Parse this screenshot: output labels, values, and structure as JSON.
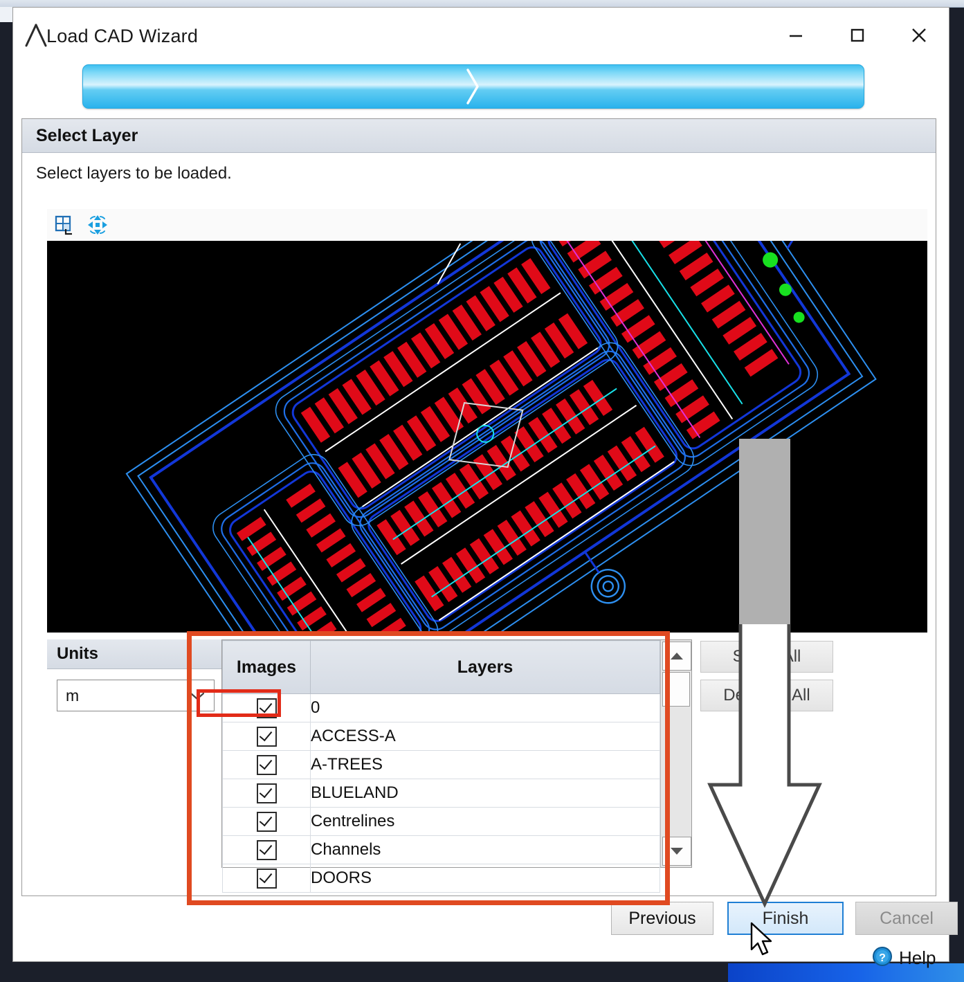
{
  "window": {
    "title": "Load CAD Wizard",
    "logo_icon": "autocad-a-icon",
    "controls": {
      "minimize": "minimize-icon",
      "maximize": "maximize-icon",
      "close": "close-icon"
    }
  },
  "progress": {
    "icon": "chevron-right-separator",
    "accent_color": "#3fc0f0"
  },
  "section": {
    "title": "Select Layer",
    "subtitle": "Select layers to be loaded."
  },
  "viewer": {
    "tools": [
      {
        "name": "zoom-window-icon",
        "label": "Zoom Window"
      },
      {
        "name": "pan-all-icon",
        "label": "Pan / Zoom Extents"
      }
    ],
    "background_color": "#000000"
  },
  "units": {
    "header": "Units",
    "selected": "m",
    "dropdown_icon": "chevron-down-icon"
  },
  "layer_table": {
    "columns": [
      "Images",
      "Layers"
    ],
    "rows": [
      {
        "checked": true,
        "name": "0"
      },
      {
        "checked": true,
        "name": "ACCESS-A"
      },
      {
        "checked": true,
        "name": "A-TREES"
      },
      {
        "checked": true,
        "name": "BLUELAND"
      },
      {
        "checked": true,
        "name": "Centrelines"
      },
      {
        "checked": true,
        "name": "Channels"
      },
      {
        "checked": true,
        "name": "DOORS"
      }
    ],
    "scrollbar": {
      "up_icon": "scroll-up-arrow-icon",
      "down_icon": "scroll-down-arrow-icon"
    }
  },
  "side_buttons": {
    "select_all": "Select All",
    "deselect_all": "Deselect All"
  },
  "footer": {
    "previous": "Previous",
    "finish": "Finish",
    "cancel": "Cancel",
    "help": "Help",
    "help_icon": "question-mark-icon"
  },
  "annotations": {
    "box_color": "#e04a21",
    "cell_highlight_color": "#e22b18",
    "arrow_color": "#4a4a4a",
    "cursor": "mouse-pointer-icon"
  }
}
